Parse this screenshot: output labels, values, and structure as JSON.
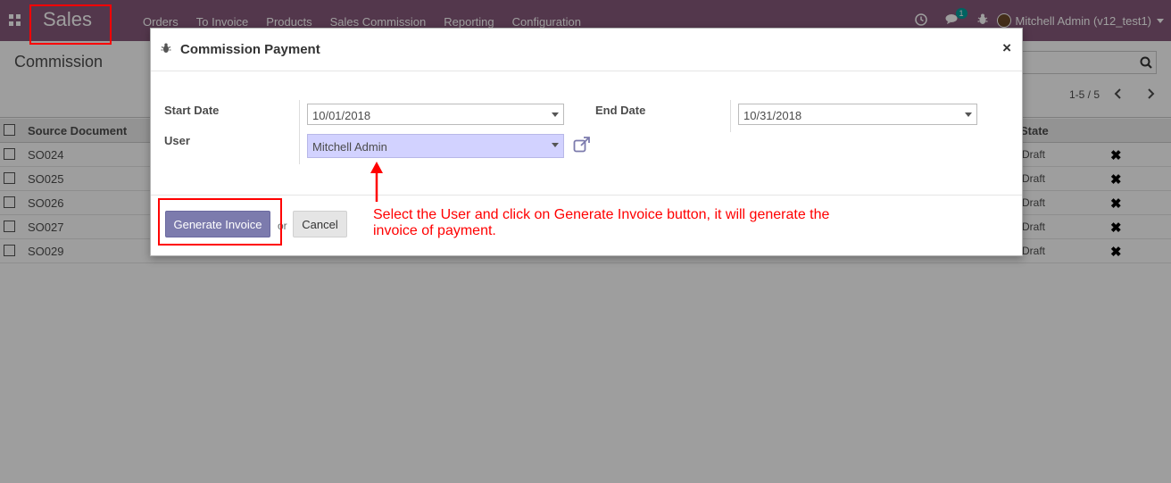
{
  "navbar": {
    "app_name": "Sales",
    "menu": [
      "Orders",
      "To Invoice",
      "Products",
      "Sales Commission",
      "Reporting",
      "Configuration"
    ],
    "chat_badge": "1",
    "user": "Mitchell Admin (v12_test1)"
  },
  "control_panel": {
    "breadcrumb": "Commission",
    "pager": "1-5 / 5"
  },
  "list": {
    "headers": {
      "source_document": "Source Document",
      "state": "State"
    },
    "rows": [
      {
        "doc": "SO024",
        "state": "Draft"
      },
      {
        "doc": "SO025",
        "state": "Draft"
      },
      {
        "doc": "SO026",
        "state": "Draft"
      },
      {
        "doc": "SO027",
        "state": "Draft"
      },
      {
        "doc": "SO029",
        "state": "Draft"
      }
    ]
  },
  "modal": {
    "title": "Commission Payment",
    "close": "×",
    "start_date_label": "Start Date",
    "start_date": "10/01/2018",
    "end_date_label": "End Date",
    "end_date": "10/31/2018",
    "user_label": "User",
    "user": "Mitchell Admin",
    "generate_button": "Generate Invoice",
    "or": "or",
    "cancel_button": "Cancel"
  },
  "annotation": {
    "note": "Select the User and click on Generate Invoice button, it will generate the invoice of payment.",
    "color": "#ff0000"
  }
}
